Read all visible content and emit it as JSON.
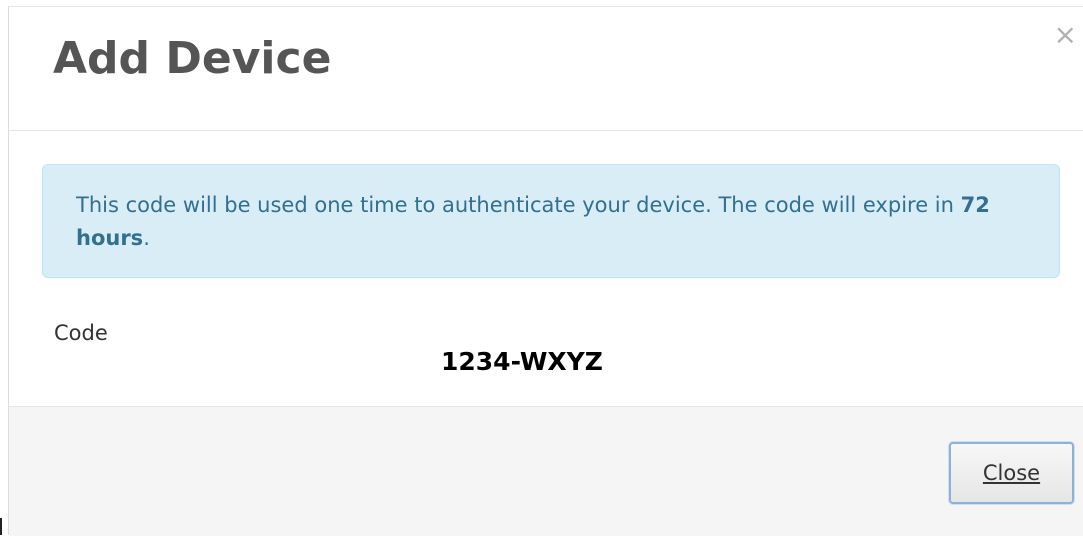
{
  "dialog": {
    "title": "Add Device",
    "close_icon": "×",
    "info_message": {
      "text_before": "This code will be used one time to authenticate your device. The code will expire in ",
      "emphasis": "72 hours",
      "text_after": "."
    },
    "code_label": "Code",
    "code_value": "1234-WXYZ",
    "close_button_label": "Close"
  },
  "colors": {
    "title": "#555555",
    "alert_background": "#d9edf7",
    "alert_border": "#bce8f1",
    "alert_text": "#31708f",
    "footer_background": "#f5f5f5",
    "button_focus_border": "#8fb1d8"
  }
}
